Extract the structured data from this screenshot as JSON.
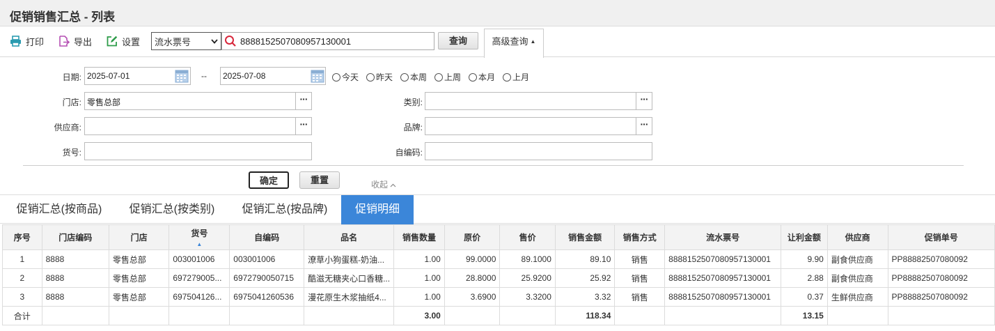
{
  "page": {
    "title": "促销销售汇总 - 列表"
  },
  "toolbar": {
    "print_label": "打印",
    "export_label": "导出",
    "settings_label": "设置",
    "search_type": "流水票号",
    "search_value": "8888152507080957130001",
    "query_label": "查询",
    "advanced_label": "高级查询"
  },
  "form": {
    "date_label": "日期:",
    "date_from": "2025-07-01",
    "date_sep": "--",
    "date_to": "2025-07-08",
    "quick_dates": [
      "今天",
      "昨天",
      "本周",
      "上周",
      "本月",
      "上月"
    ],
    "store_label": "门店:",
    "store_value": "零售总部",
    "category_label": "类别:",
    "category_value": "",
    "supplier_label": "供应商:",
    "supplier_value": "",
    "brand_label": "品牌:",
    "brand_value": "",
    "item_no_label": "货号:",
    "item_no_value": "",
    "self_code_label": "自编码:",
    "self_code_value": "",
    "confirm_label": "确定",
    "reset_label": "重置",
    "collapse_label": "收起"
  },
  "tabs": [
    {
      "label": "促销汇总(按商品)",
      "active": false
    },
    {
      "label": "促销汇总(按类别)",
      "active": false
    },
    {
      "label": "促销汇总(按品牌)",
      "active": false
    },
    {
      "label": "促销明细",
      "active": true
    }
  ],
  "table": {
    "columns": [
      "序号",
      "门店编码",
      "门店",
      "货号",
      "自编码",
      "品名",
      "销售数量",
      "原价",
      "售价",
      "销售金额",
      "销售方式",
      "流水票号",
      "让利金额",
      "供应商",
      "促销单号"
    ],
    "sorted_column": "货号",
    "rows": [
      [
        "1",
        "8888",
        "零售总部",
        "003001006",
        "003001006",
        "潦草小狗蛋糕-奶油...",
        "1.00",
        "99.0000",
        "89.1000",
        "89.10",
        "销售",
        "8888152507080957130001",
        "9.90",
        "副食供应商",
        "PP88882507080092"
      ],
      [
        "2",
        "8888",
        "零售总部",
        "697279005...",
        "6972790050715",
        "酷滋无糖夹心口香糖...",
        "1.00",
        "28.8000",
        "25.9200",
        "25.92",
        "销售",
        "8888152507080957130001",
        "2.88",
        "副食供应商",
        "PP88882507080092"
      ],
      [
        "3",
        "8888",
        "零售总部",
        "697504126...",
        "6975041260536",
        "漫花原生木浆抽纸4...",
        "1.00",
        "3.6900",
        "3.3200",
        "3.32",
        "销售",
        "8888152507080957130001",
        "0.37",
        "生鲜供应商",
        "PP88882507080092"
      ]
    ],
    "total": {
      "label": "合计",
      "qty": "3.00",
      "amount": "118.34",
      "discount": "13.15"
    }
  },
  "colors": {
    "accent": "#3b86d9",
    "header_bg": "#f3f3f3",
    "title_bg": "#f0f0f0"
  }
}
